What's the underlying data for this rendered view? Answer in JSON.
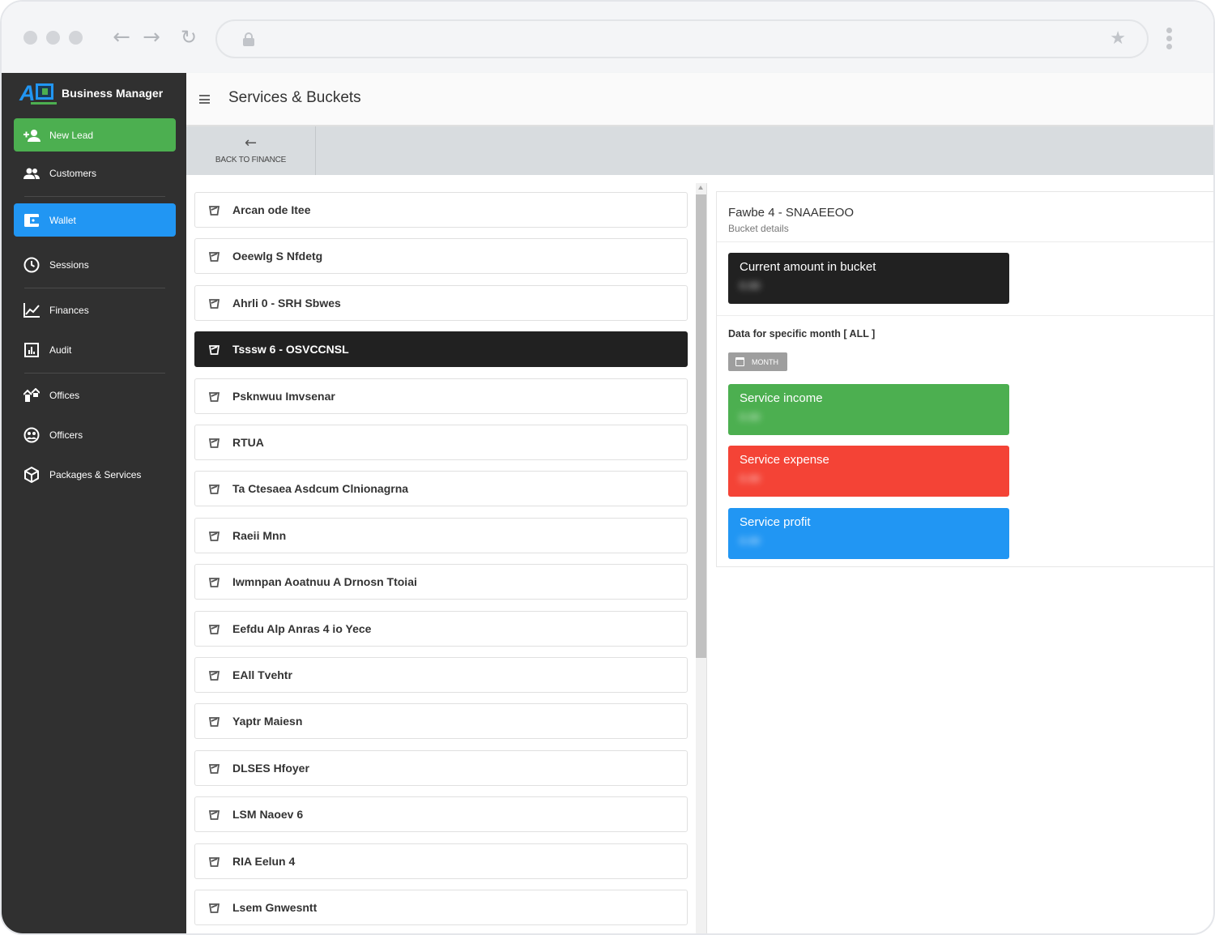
{
  "brand": {
    "name": "Business Manager"
  },
  "sidebar": {
    "items": [
      {
        "label": "New Lead",
        "icon": "person-add-icon"
      },
      {
        "label": "Customers",
        "icon": "people-icon"
      },
      {
        "label": "Wallet",
        "icon": "wallet-icon"
      },
      {
        "label": "Sessions",
        "icon": "clock-icon"
      },
      {
        "label": "Finances",
        "icon": "chart-line-icon"
      },
      {
        "label": "Audit",
        "icon": "bar-chart-icon"
      },
      {
        "label": "Offices",
        "icon": "offices-icon"
      },
      {
        "label": "Officers",
        "icon": "officers-icon"
      },
      {
        "label": "Packages & Services",
        "icon": "package-icon"
      }
    ]
  },
  "header": {
    "title": "Services & Buckets"
  },
  "toolbar": {
    "back_label": "BACK TO FINANCE"
  },
  "services": {
    "items": [
      "Arcan ode Itee",
      "Oeewlg S Nfdetg",
      "Ahrli 0 - SRH Sbwes",
      "Tsssw 6 - OSVCCNSL",
      "Psknwuu Imvsenar",
      "RTUA",
      "Ta Ctesaea Asdcum Clnionagrna",
      "Raeii Mnn",
      "Iwmnpan Aoatnuu A Drnosn Ttoiai",
      "Eefdu Alp Anras 4 io Yece",
      "EAll Tvehtr",
      "Yaptr Maiesn",
      "DLSES Hfoyer",
      "LSM Naoev 6",
      "RIA Eelun 4",
      "Lsem Gnwesntt"
    ],
    "active_index": 3
  },
  "detail": {
    "title": "Fawbe 4 - SNAAEEOO",
    "subtitle": "Bucket details",
    "current_amount_label": "Current amount in bucket",
    "current_amount_value": "0.00",
    "month_label": "Data for specific month [ ALL ]",
    "month_button": "MONTH",
    "income_label": "Service income",
    "income_value": "0.00",
    "expense_label": "Service expense",
    "expense_value": "0.00",
    "profit_label": "Service profit",
    "profit_value": "0.00"
  },
  "colors": {
    "sidebar_bg": "#303030",
    "new_lead": "#4caf50",
    "wallet_active": "#2196f3",
    "income": "#4caf50",
    "expense": "#f44336",
    "profit": "#2196f3",
    "current_amount": "#212121"
  }
}
